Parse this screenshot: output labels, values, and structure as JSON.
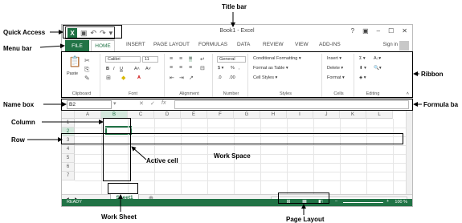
{
  "annotations": {
    "title_bar": "Title bar",
    "quick_access": "Quick Access",
    "menu_bar": "Menu bar",
    "ribbon": "Ribbon",
    "name_box": "Name box",
    "formula_bar": "Formula ba",
    "column": "Column",
    "row": "Row",
    "active_cell": "Active cell",
    "work_space": "Work Space",
    "work_sheet": "Work Sheet",
    "page_layout": "Page Layout"
  },
  "window": {
    "title": "Book1 - Excel",
    "controls": [
      "?",
      "▣",
      "–",
      "☐",
      "✕"
    ]
  },
  "menu": {
    "file": "FILE",
    "tabs": [
      "HOME",
      "INSERT",
      "PAGE LAYOUT",
      "FORMULAS",
      "DATA",
      "REVIEW",
      "VIEW",
      "ADD-INS"
    ],
    "sign_in": "Sign in"
  },
  "ribbon": {
    "groups": [
      "Clipboard",
      "Font",
      "Alignment",
      "Number",
      "Styles",
      "Cells",
      "Editing"
    ],
    "paste": "Paste",
    "font_name": "Calibri",
    "font_size": "11",
    "number_format": "General",
    "styles": [
      "Conditional Formatting ▾",
      "Format as Table ▾",
      "Cell Styles ▾"
    ],
    "cells": [
      "Insert ▾",
      "Delete ▾",
      "Format ▾"
    ]
  },
  "formula_bar": {
    "name_box_value": "B2",
    "fx": "fx"
  },
  "grid": {
    "columns": [
      "A",
      "B",
      "C",
      "D",
      "E",
      "F",
      "G",
      "H",
      "I",
      "J",
      "K",
      "L"
    ],
    "rows": [
      "1",
      "2",
      "3",
      "4",
      "5",
      "6",
      "7"
    ],
    "active_cell": "B2"
  },
  "sheets": {
    "tabs": [
      "Sheet1"
    ],
    "add": "⊕"
  },
  "status": {
    "ready": "READY",
    "zoom": "100 %"
  },
  "colors": {
    "excel_green": "#217346"
  }
}
